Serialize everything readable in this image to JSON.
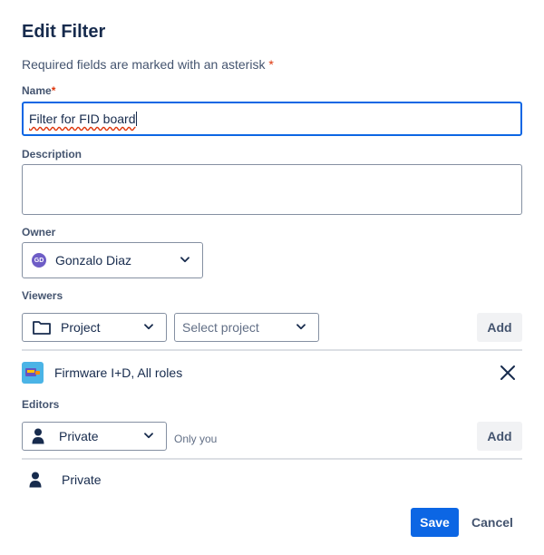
{
  "dialog": {
    "title": "Edit Filter",
    "required_note": "Required fields are marked with an asterisk",
    "required_marker": "*"
  },
  "fields": {
    "name": {
      "label": "Name",
      "value": "Filter for FID board"
    },
    "description": {
      "label": "Description",
      "value": ""
    },
    "owner": {
      "label": "Owner",
      "value": "Gonzalo Diaz",
      "avatar_initials": "GD"
    }
  },
  "viewers": {
    "label": "Viewers",
    "type_value": "Project",
    "project_placeholder": "Select project",
    "add_label": "Add",
    "entries": [
      {
        "label": "Firmware I+D, All roles",
        "icon": "project-avatar-icon"
      }
    ]
  },
  "editors": {
    "label": "Editors",
    "type_value": "Private",
    "hint": "Only you",
    "add_label": "Add",
    "entries": [
      {
        "label": "Private",
        "icon": "person-icon"
      }
    ]
  },
  "footer": {
    "save_label": "Save",
    "cancel_label": "Cancel"
  },
  "colors": {
    "primary": "#0c66e4",
    "asterisk": "#de350b",
    "text": "#172b4d",
    "subtle_text": "#44546f"
  }
}
